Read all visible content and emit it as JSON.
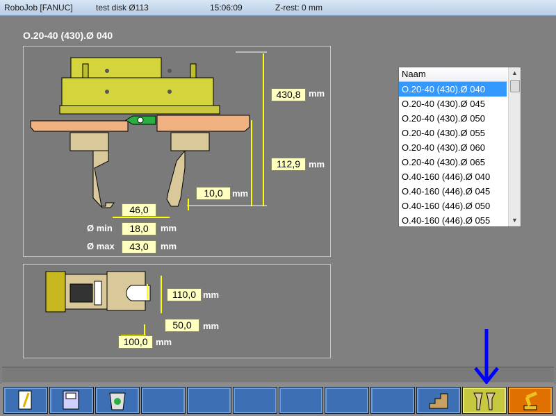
{
  "titlebar": {
    "app": "RoboJob [FANUC]",
    "disk": "test disk Ø113",
    "time": "15:06:09",
    "zrest": "Z-rest: 0 mm"
  },
  "gripper": {
    "title": "O.20-40 (430).Ø 040",
    "height_total": "430,8",
    "height_finger": "112,9",
    "tip": "10,0",
    "width": "46,0",
    "dmin_label": "Ø min",
    "dmin": "18,0",
    "dmax_label": "Ø max",
    "dmax": "43,0",
    "unit": "mm"
  },
  "sideview": {
    "height": "110,0",
    "depth": "50,0",
    "length": "100,0",
    "unit": "mm"
  },
  "list": {
    "header": "Naam",
    "items": [
      "O.20-40 (430).Ø 040",
      "O.20-40 (430).Ø 045",
      "O.20-40 (430).Ø 050",
      "O.20-40 (430).Ø 055",
      "O.20-40 (430).Ø 060",
      "O.20-40 (430).Ø 065",
      "O.40-160 (446).Ø 040",
      "O.40-160 (446).Ø 045",
      "O.40-160 (446).Ø 050",
      "O.40-160 (446).Ø 055"
    ],
    "selected_index": 0
  },
  "toolbar": {
    "buttons": [
      "edit-icon",
      "save-icon",
      "recycle-bin-icon",
      "empty",
      "empty",
      "empty",
      "empty",
      "empty",
      "empty",
      "steps-icon",
      "gripper-icon",
      "robot-icon"
    ],
    "active_color": "#c8c840",
    "robot_color": "#e07000"
  },
  "colors": {
    "arrow": "#0000ff",
    "dimension": "#ffff00"
  }
}
